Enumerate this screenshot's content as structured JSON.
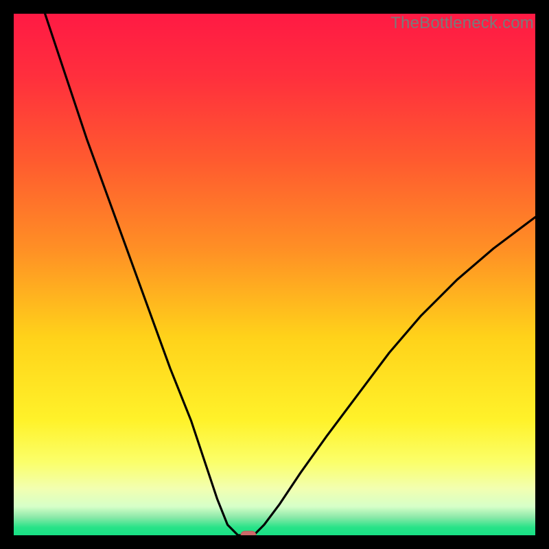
{
  "watermark": "TheBottleneck.com",
  "colors": {
    "frame": "#000000",
    "gradient_stops": [
      {
        "offset": 0.0,
        "color": "#ff1a44"
      },
      {
        "offset": 0.12,
        "color": "#ff2f3d"
      },
      {
        "offset": 0.28,
        "color": "#ff5a2f"
      },
      {
        "offset": 0.45,
        "color": "#ff8f25"
      },
      {
        "offset": 0.62,
        "color": "#ffd21a"
      },
      {
        "offset": 0.78,
        "color": "#fff22a"
      },
      {
        "offset": 0.86,
        "color": "#fbff6a"
      },
      {
        "offset": 0.91,
        "color": "#f2ffb0"
      },
      {
        "offset": 0.945,
        "color": "#d6ffc8"
      },
      {
        "offset": 0.965,
        "color": "#8de9a9"
      },
      {
        "offset": 0.985,
        "color": "#27e388"
      },
      {
        "offset": 1.0,
        "color": "#18df84"
      }
    ],
    "curve": "#000000",
    "marker_fill": "#cc6a6a",
    "marker_stroke": "#b85a5a"
  },
  "chart_data": {
    "type": "line",
    "title": "",
    "xlabel": "",
    "ylabel": "",
    "xlim": [
      0,
      100
    ],
    "ylim": [
      0,
      100
    ],
    "note": "Bottleneck-style V curve. x ≈ relative component balance; y ≈ bottleneck %. Minimum near x≈43 with a short flat bottom; left branch steeper than right. Values are read from pixel positions (no axes/ticks shown).",
    "series": [
      {
        "name": "bottleneck-curve",
        "x": [
          6,
          10,
          14,
          18,
          22,
          26,
          30,
          34,
          37,
          39,
          41,
          43,
          46,
          48,
          51,
          55,
          60,
          66,
          72,
          78,
          85,
          92,
          100
        ],
        "y": [
          100,
          88,
          76,
          65,
          54,
          43,
          32,
          22,
          13,
          7,
          2,
          0,
          0,
          2,
          6,
          12,
          19,
          27,
          35,
          42,
          49,
          55,
          61
        ]
      }
    ],
    "flat_min_segment": {
      "x_start": 40,
      "x_end": 46,
      "y": 0
    },
    "marker": {
      "x": 45,
      "y": 0,
      "shape": "pill"
    }
  }
}
